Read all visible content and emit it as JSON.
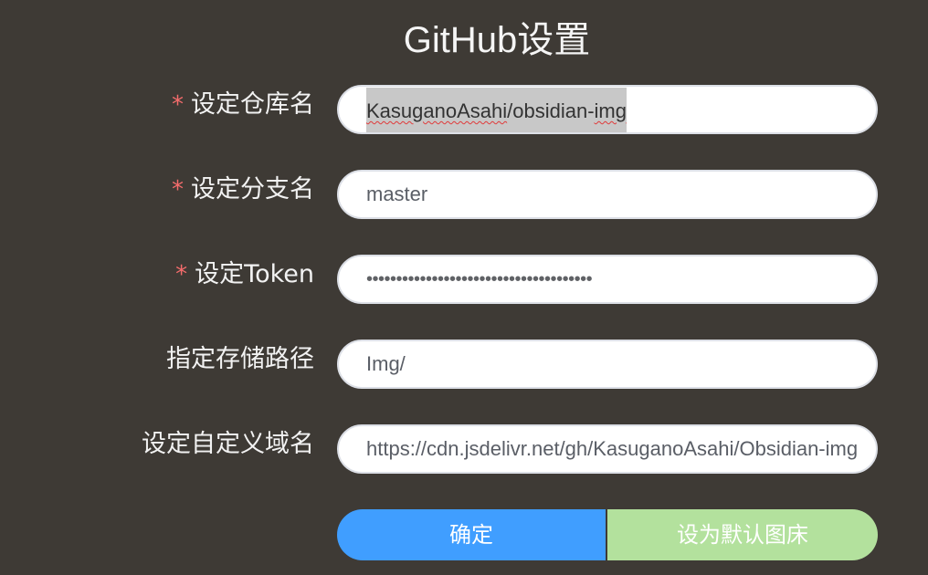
{
  "title": "GitHub设置",
  "required_mark": "*",
  "form": {
    "repo": {
      "label": "设定仓库名",
      "value_user": "KasuganoAsahi",
      "value_sep": "/obsidian-",
      "value_suffix": "img"
    },
    "branch": {
      "label": "设定分支名",
      "value": "master"
    },
    "token": {
      "label": "设定Token",
      "value": "••••••••••••••••••••••••••••••••••••••"
    },
    "path": {
      "label": "指定存储路径",
      "value": "Img/"
    },
    "domain": {
      "label": "设定自定义域名",
      "value": "https://cdn.jsdelivr.net/gh/KasuganoAsahi/Obsidian-img"
    }
  },
  "buttons": {
    "confirm": "确定",
    "set_default": "设为默认图床"
  },
  "colors": {
    "background": "#3e3a35",
    "required": "#f56c6c",
    "primary": "#409eff",
    "success_light": "#b3e19d"
  }
}
